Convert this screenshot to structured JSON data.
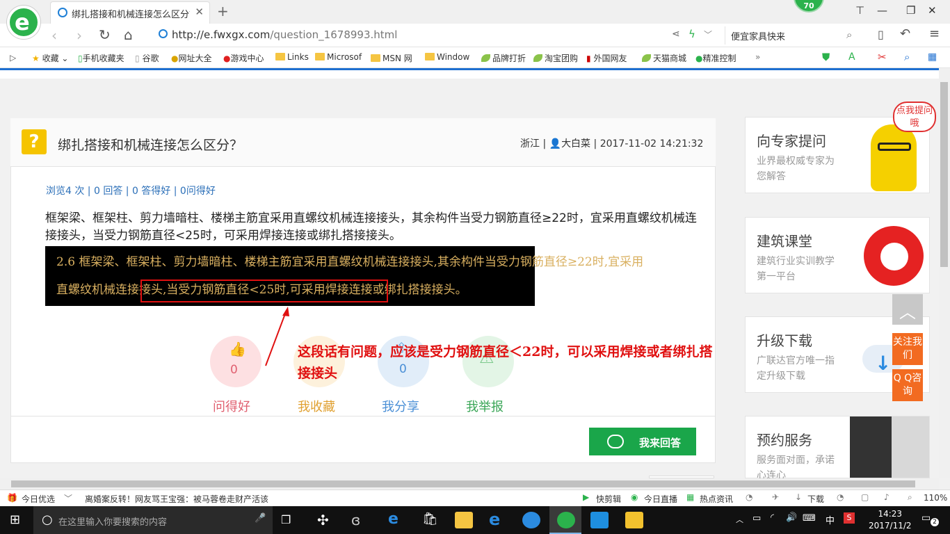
{
  "browser": {
    "tab_title": "绑扎搭接和机械连接怎么区分？_",
    "badge": "70",
    "url_prefix": "http://e.",
    "url_domain": "fwxgx.com",
    "url_path": "/question_1678993.html",
    "search_text": "便宜家具快来",
    "bookmarks": [
      "收藏",
      "手机收藏夹",
      "谷歌",
      "网址大全",
      "游戏中心",
      "Links",
      "Microsof",
      "MSN 网",
      "Window",
      "品牌打折",
      "淘宝团购",
      "外国网友",
      "天猫商城",
      "精准控制"
    ]
  },
  "question": {
    "mark": "?",
    "title": "绑扎搭接和机械连接怎么区分？",
    "location": "浙江",
    "user": "大白菜",
    "time": "2017-11-02 14:21:32",
    "stats": "浏览4 次 | 0 回答 | 0 答得好 | 0问得好",
    "answer_text": "框架梁、框架柱、剪力墙暗柱、楼梯主筋宜采用直螺纹机械连接接头，其余构件当受力钢筋直径≥22时，宜采用直螺纹机械连接接头，当受力钢筋直径<25时，可采用焊接连接或绑扎搭接接头。",
    "image_line1": "2.6  框架梁、框架柱、剪力墙暗柱、楼梯主筋宜采用直螺纹机械连接接头,其余构件当受力钢筋直径≥22时,宜采用",
    "image_line2": "直螺纹机械连接接头,当受力钢筋直径<25时,可采用焊接连接或绑扎搭接接头。",
    "annotation": "这段话有问题，应该是受力钢筋直径＜22时，可以采用焊接或者绑扎搭接接头",
    "like_count": "0",
    "share_count": "0",
    "actions": [
      "问得好",
      "我收藏",
      "我分享",
      "我举报"
    ],
    "answer_button": "我来回答"
  },
  "sidebar": {
    "cards": [
      {
        "title": "向专家提问",
        "sub": "业界最权威专家为您解答"
      },
      {
        "title": "建筑课堂",
        "sub": "建筑行业实训教学第一平台"
      },
      {
        "title": "升级下载",
        "sub": "广联达官方唯一指定升级下载"
      },
      {
        "title": "预约服务",
        "sub": "服务面对面，承诺心连心"
      }
    ],
    "bubble": "点我提问哦",
    "follow": "关注我们",
    "qq": "Q Q咨询"
  },
  "statusbar": {
    "today": "今日优选",
    "news": "离婚案反转！网友骂王宝强：被马蓉卷走财产活该",
    "items": [
      "快剪辑",
      "今日直播",
      "热点资讯",
      "下载"
    ],
    "zoom": "110%"
  },
  "taskbar": {
    "search_placeholder": "在这里输入你要搜索的内容",
    "ime": "中",
    "time": "14:23",
    "date": "2017/11/2",
    "notif": "2"
  },
  "colors": {
    "accent_green": "#1aa64a",
    "brand_blue": "#1e6fd0",
    "annotation_red": "#e01010",
    "orange": "#f26b21"
  }
}
